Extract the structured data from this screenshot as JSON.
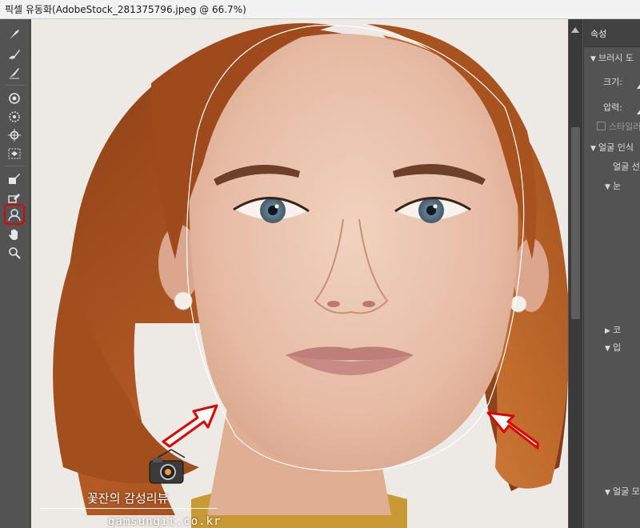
{
  "window": {
    "title": "픽셀 유동화(AdobeStock_281375796.jpeg @ 66.7%)"
  },
  "toolbar": {
    "tools": [
      {
        "name": "forward-warp-tool",
        "icon": "forward-warp-icon"
      },
      {
        "name": "reconstruct-tool",
        "icon": "reconstruct-icon"
      },
      {
        "name": "smooth-tool",
        "icon": "smooth-icon"
      },
      {
        "name": "twirl-tool",
        "icon": "twirl-icon"
      },
      {
        "name": "pucker-tool",
        "icon": "pucker-icon"
      },
      {
        "name": "bloat-tool",
        "icon": "bloat-icon"
      },
      {
        "name": "push-left-tool",
        "icon": "push-left-icon"
      },
      {
        "name": "freeze-mask-tool",
        "icon": "freeze-mask-icon"
      },
      {
        "name": "thaw-mask-tool",
        "icon": "thaw-mask-icon"
      },
      {
        "name": "face-tool",
        "icon": "face-tool-icon",
        "active": true
      },
      {
        "name": "hand-tool",
        "icon": "hand-icon"
      },
      {
        "name": "zoom-tool",
        "icon": "zoom-icon"
      }
    ],
    "active_outline_color": "#e00000"
  },
  "panel": {
    "tab_label": "속성",
    "brush_section": "브러시 도",
    "size_label": "크기:",
    "pressure_label": "압력:",
    "stylus_label": "스타일러",
    "face_section": "얼굴 인식",
    "face_select_label": "얼굴 선",
    "eyes_label": "눈",
    "nose_label": "코",
    "mouth_label": "입",
    "face_shape_label": "얼굴 모"
  },
  "canvas": {
    "face_overlay_color": "#ffffff",
    "arrow_color": "#e00000"
  },
  "watermark": {
    "title": "꽃잔의 감성리뷰",
    "url": "gamsungit.co.kr"
  }
}
